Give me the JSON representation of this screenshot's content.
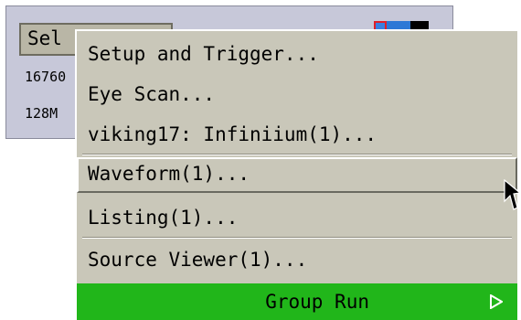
{
  "background_panel": {
    "select_button_label": "Sel",
    "row_labels": [
      "16760",
      "128M"
    ],
    "swatch_colors": [
      "#3a7fe0",
      "#2d78d6",
      "#000000"
    ]
  },
  "menu": {
    "items": [
      {
        "label": "Setup and Trigger..."
      },
      {
        "label": "Eye Scan..."
      },
      {
        "label": "viking17: Infiniium(1)..."
      },
      {
        "label": "Waveform(1)...",
        "highlighted": true
      },
      {
        "label": "Listing(1)..."
      },
      {
        "label": "Source Viewer(1)..."
      }
    ],
    "group_run_label": "Group Run",
    "group_run_color": "#21b61a"
  }
}
